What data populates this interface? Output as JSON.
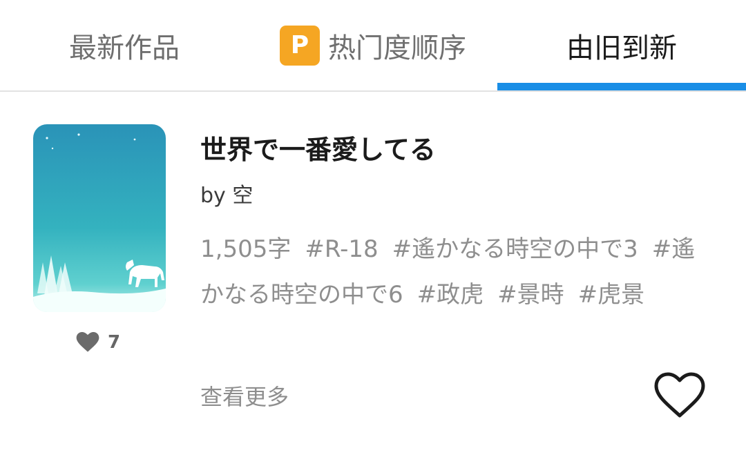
{
  "tabs": [
    {
      "label": "最新作品"
    },
    {
      "label": "热门度顺序",
      "badge": "P"
    },
    {
      "label": "由旧到新",
      "active": true
    }
  ],
  "work": {
    "title": "世界で一番愛してる",
    "author": "by 空",
    "char_count": "1,505字",
    "tags": [
      "#R-18",
      "#遙かなる時空の中で3",
      "#遙かなる時空の中で6",
      "#政虎",
      "#景時",
      "#虎景"
    ],
    "likes": "7",
    "more_label": "查看更多",
    "cover_icon": "cover-image"
  },
  "colors": {
    "accent": "#1a8ee6",
    "badge": "#f5a623"
  }
}
